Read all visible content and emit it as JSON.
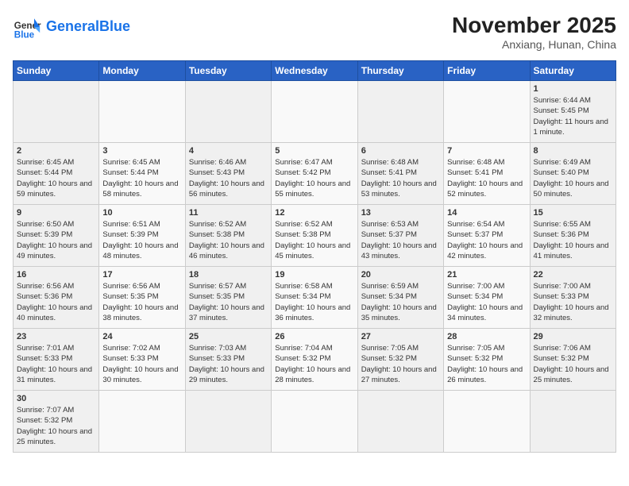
{
  "header": {
    "logo_general": "General",
    "logo_blue": "Blue",
    "month_title": "November 2025",
    "location": "Anxiang, Hunan, China"
  },
  "weekdays": [
    "Sunday",
    "Monday",
    "Tuesday",
    "Wednesday",
    "Thursday",
    "Friday",
    "Saturday"
  ],
  "days": [
    {
      "num": "",
      "info": ""
    },
    {
      "num": "",
      "info": ""
    },
    {
      "num": "",
      "info": ""
    },
    {
      "num": "",
      "info": ""
    },
    {
      "num": "",
      "info": ""
    },
    {
      "num": "",
      "info": ""
    },
    {
      "num": "1",
      "info": "Sunrise: 6:44 AM\nSunset: 5:45 PM\nDaylight: 11 hours and 1 minute."
    },
    {
      "num": "2",
      "info": "Sunrise: 6:45 AM\nSunset: 5:44 PM\nDaylight: 10 hours and 59 minutes."
    },
    {
      "num": "3",
      "info": "Sunrise: 6:45 AM\nSunset: 5:44 PM\nDaylight: 10 hours and 58 minutes."
    },
    {
      "num": "4",
      "info": "Sunrise: 6:46 AM\nSunset: 5:43 PM\nDaylight: 10 hours and 56 minutes."
    },
    {
      "num": "5",
      "info": "Sunrise: 6:47 AM\nSunset: 5:42 PM\nDaylight: 10 hours and 55 minutes."
    },
    {
      "num": "6",
      "info": "Sunrise: 6:48 AM\nSunset: 5:41 PM\nDaylight: 10 hours and 53 minutes."
    },
    {
      "num": "7",
      "info": "Sunrise: 6:48 AM\nSunset: 5:41 PM\nDaylight: 10 hours and 52 minutes."
    },
    {
      "num": "8",
      "info": "Sunrise: 6:49 AM\nSunset: 5:40 PM\nDaylight: 10 hours and 50 minutes."
    },
    {
      "num": "9",
      "info": "Sunrise: 6:50 AM\nSunset: 5:39 PM\nDaylight: 10 hours and 49 minutes."
    },
    {
      "num": "10",
      "info": "Sunrise: 6:51 AM\nSunset: 5:39 PM\nDaylight: 10 hours and 48 minutes."
    },
    {
      "num": "11",
      "info": "Sunrise: 6:52 AM\nSunset: 5:38 PM\nDaylight: 10 hours and 46 minutes."
    },
    {
      "num": "12",
      "info": "Sunrise: 6:52 AM\nSunset: 5:38 PM\nDaylight: 10 hours and 45 minutes."
    },
    {
      "num": "13",
      "info": "Sunrise: 6:53 AM\nSunset: 5:37 PM\nDaylight: 10 hours and 43 minutes."
    },
    {
      "num": "14",
      "info": "Sunrise: 6:54 AM\nSunset: 5:37 PM\nDaylight: 10 hours and 42 minutes."
    },
    {
      "num": "15",
      "info": "Sunrise: 6:55 AM\nSunset: 5:36 PM\nDaylight: 10 hours and 41 minutes."
    },
    {
      "num": "16",
      "info": "Sunrise: 6:56 AM\nSunset: 5:36 PM\nDaylight: 10 hours and 40 minutes."
    },
    {
      "num": "17",
      "info": "Sunrise: 6:56 AM\nSunset: 5:35 PM\nDaylight: 10 hours and 38 minutes."
    },
    {
      "num": "18",
      "info": "Sunrise: 6:57 AM\nSunset: 5:35 PM\nDaylight: 10 hours and 37 minutes."
    },
    {
      "num": "19",
      "info": "Sunrise: 6:58 AM\nSunset: 5:34 PM\nDaylight: 10 hours and 36 minutes."
    },
    {
      "num": "20",
      "info": "Sunrise: 6:59 AM\nSunset: 5:34 PM\nDaylight: 10 hours and 35 minutes."
    },
    {
      "num": "21",
      "info": "Sunrise: 7:00 AM\nSunset: 5:34 PM\nDaylight: 10 hours and 34 minutes."
    },
    {
      "num": "22",
      "info": "Sunrise: 7:00 AM\nSunset: 5:33 PM\nDaylight: 10 hours and 32 minutes."
    },
    {
      "num": "23",
      "info": "Sunrise: 7:01 AM\nSunset: 5:33 PM\nDaylight: 10 hours and 31 minutes."
    },
    {
      "num": "24",
      "info": "Sunrise: 7:02 AM\nSunset: 5:33 PM\nDaylight: 10 hours and 30 minutes."
    },
    {
      "num": "25",
      "info": "Sunrise: 7:03 AM\nSunset: 5:33 PM\nDaylight: 10 hours and 29 minutes."
    },
    {
      "num": "26",
      "info": "Sunrise: 7:04 AM\nSunset: 5:32 PM\nDaylight: 10 hours and 28 minutes."
    },
    {
      "num": "27",
      "info": "Sunrise: 7:05 AM\nSunset: 5:32 PM\nDaylight: 10 hours and 27 minutes."
    },
    {
      "num": "28",
      "info": "Sunrise: 7:05 AM\nSunset: 5:32 PM\nDaylight: 10 hours and 26 minutes."
    },
    {
      "num": "29",
      "info": "Sunrise: 7:06 AM\nSunset: 5:32 PM\nDaylight: 10 hours and 25 minutes."
    },
    {
      "num": "30",
      "info": "Sunrise: 7:07 AM\nSunset: 5:32 PM\nDaylight: 10 hours and 25 minutes."
    },
    {
      "num": "",
      "info": ""
    },
    {
      "num": "",
      "info": ""
    },
    {
      "num": "",
      "info": ""
    },
    {
      "num": "",
      "info": ""
    },
    {
      "num": "",
      "info": ""
    },
    {
      "num": "",
      "info": ""
    }
  ]
}
